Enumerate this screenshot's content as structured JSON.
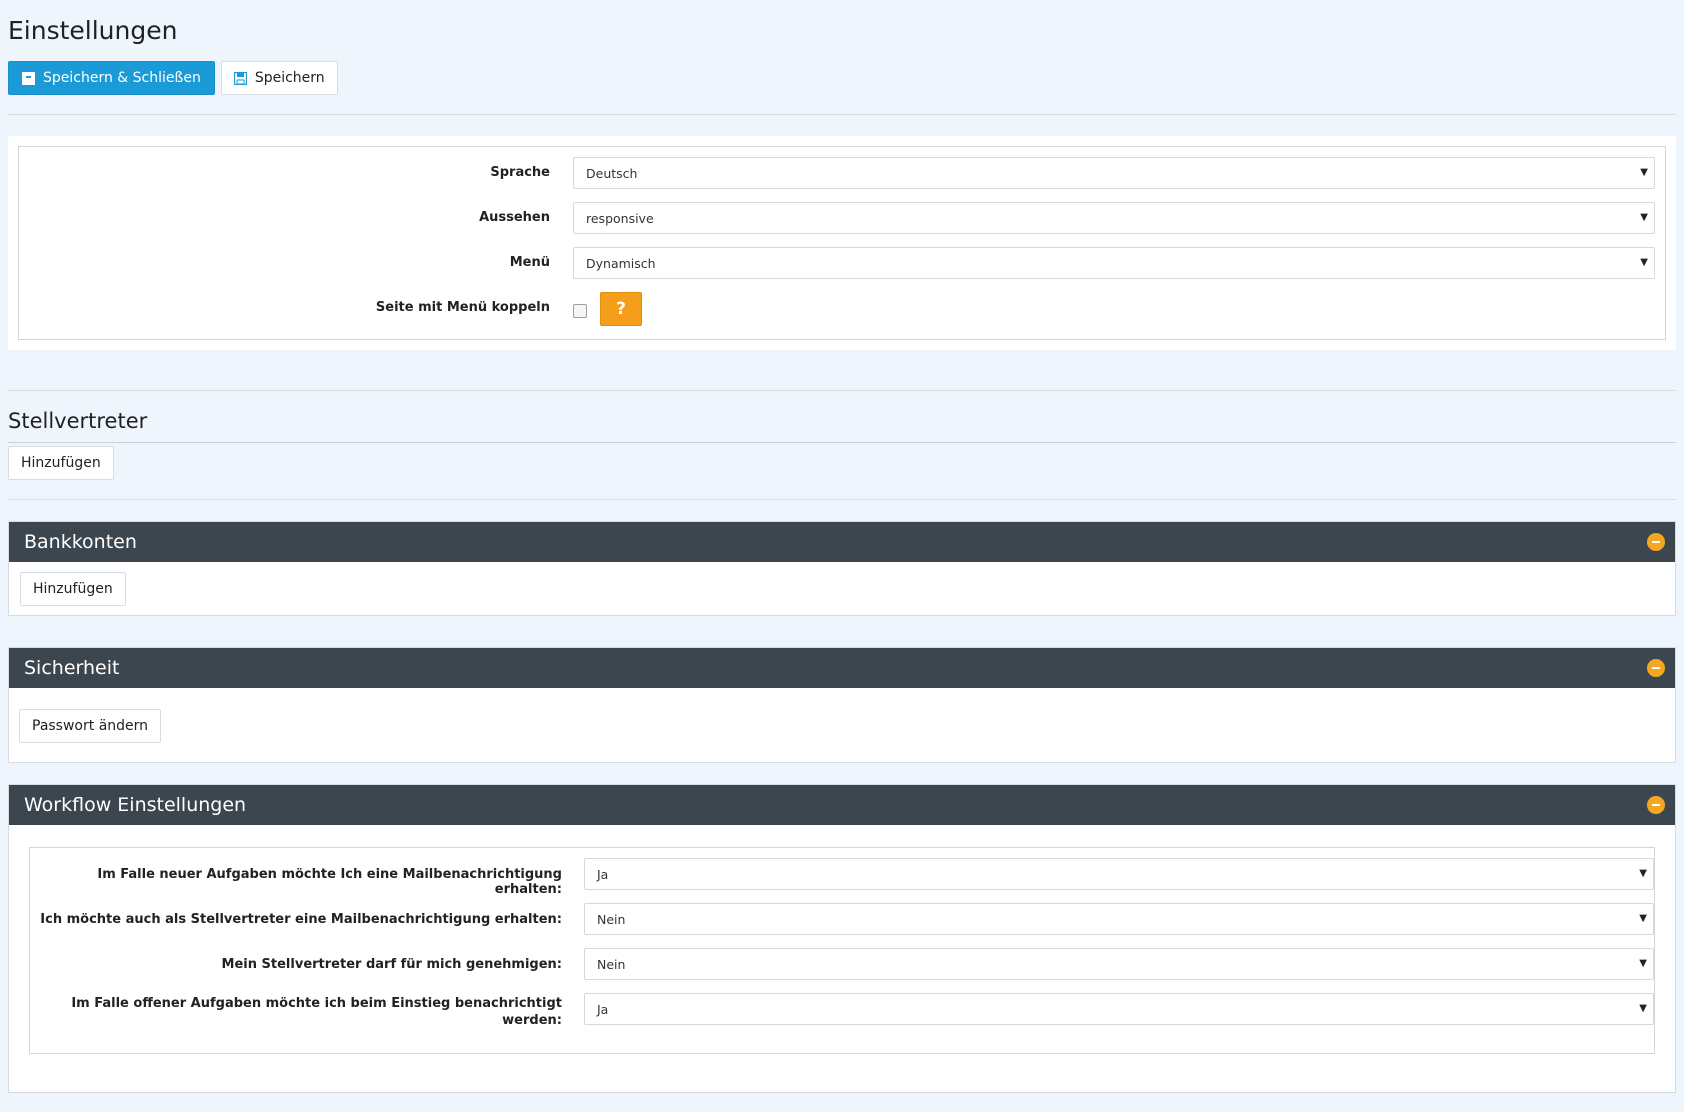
{
  "page": {
    "title": "Einstellungen"
  },
  "toolbar": {
    "save_close_label": "Speichern & Schließen",
    "save_label": "Speichern"
  },
  "settings": {
    "language": {
      "label": "Sprache",
      "value": "Deutsch"
    },
    "appearance": {
      "label": "Aussehen",
      "value": "responsive"
    },
    "menu": {
      "label": "Menü",
      "value": "Dynamisch"
    },
    "couple": {
      "label": "Seite mit Menü koppeln",
      "help": "?"
    }
  },
  "deputy": {
    "title": "Stellvertreter",
    "add_label": "Hinzufügen"
  },
  "bank": {
    "title": "Bankkonten",
    "add_label": "Hinzufügen"
  },
  "security": {
    "title": "Sicherheit",
    "change_password_label": "Passwort ändern"
  },
  "workflow": {
    "title": "Workflow Einstellungen",
    "rows": [
      {
        "label": "Im Falle neuer Aufgaben möchte Ich eine Mailbenachrichtigung erhalten:",
        "value": "Ja"
      },
      {
        "label": "Ich möchte auch als Stellvertreter eine Mailbenachrichtigung erhalten:",
        "value": "Nein"
      },
      {
        "label": "Mein Stellvertreter darf für mich genehmigen:",
        "value": "Nein"
      },
      {
        "label": "Im Falle offener Aufgaben möchte ich beim Einstieg benachrichtigt werden:",
        "value": "Ja"
      }
    ]
  }
}
